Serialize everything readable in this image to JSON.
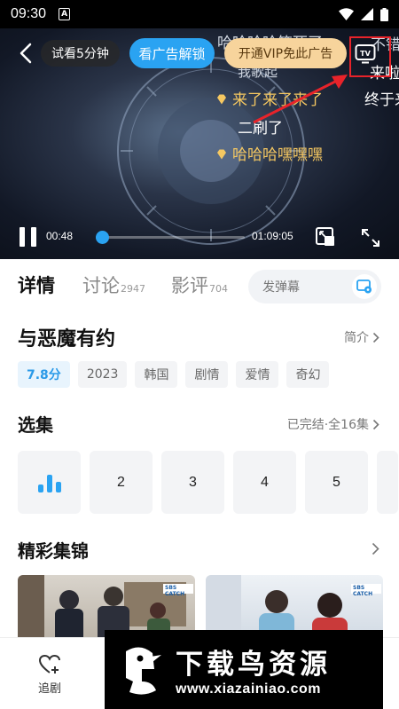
{
  "status_bar": {
    "time": "09:30",
    "notification_glyph": "A"
  },
  "player": {
    "trial_label": "试看5分钟",
    "unlock_ad_label": "看广告解锁",
    "vip_label": "开通VIP免此广告",
    "tv_label": "TV",
    "current_time": "00:48",
    "total_time": "01:09:05",
    "progress": 0.04,
    "danmaku": [
      {
        "text": "哈哈哈哈笑死了",
        "style": "dim"
      },
      {
        "text": "不错",
        "style": "dim"
      },
      {
        "text": "我歌起",
        "style": "dim"
      },
      {
        "text": "来啦",
        "style": "white"
      },
      {
        "text": "来了来了来了",
        "style": "gold"
      },
      {
        "text": "终于来",
        "style": "white"
      },
      {
        "text": "二刷了",
        "style": "white"
      },
      {
        "text": "哈哈哈嘿嘿嘿",
        "style": "gold"
      }
    ],
    "accent": "#2aa3f2"
  },
  "tabs": [
    {
      "label": "详情",
      "count": ""
    },
    {
      "label": "讨论",
      "count": "2947"
    },
    {
      "label": "影评",
      "count": "704"
    }
  ],
  "danmu_input": {
    "placeholder": "发弹幕"
  },
  "show": {
    "title": "与恶魔有约",
    "intro_label": "简介",
    "score": "7.8分",
    "tags": [
      "2023",
      "韩国",
      "剧情",
      "爱情",
      "奇幻"
    ]
  },
  "episodes": {
    "title": "选集",
    "status": "已完结·全16集",
    "items": [
      "",
      "2",
      "3",
      "4",
      "5"
    ]
  },
  "highlights": {
    "title": "精彩集锦",
    "clip_logo": "SBS CATCH"
  },
  "bottom_bar": {
    "follow_label": "追剧"
  },
  "watermark": {
    "title": "下载鸟资源",
    "url": "www.xiazainiao.com"
  }
}
